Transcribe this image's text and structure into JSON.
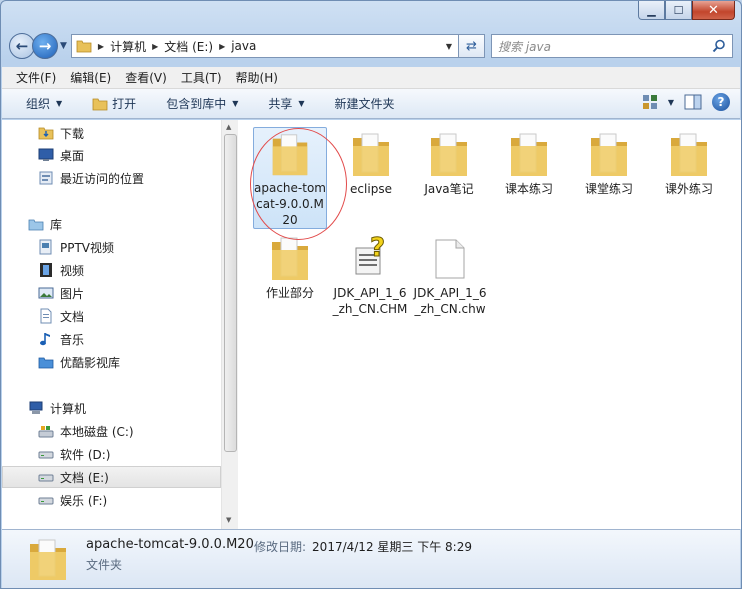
{
  "window": {
    "caption": {
      "minimize": "▁",
      "maximize": "☐",
      "close": "✕"
    }
  },
  "address": {
    "segments": [
      "计算机",
      "文档 (E:)",
      "java"
    ],
    "search_placeholder": "搜索 java"
  },
  "menubar": [
    "文件(F)",
    "编辑(E)",
    "查看(V)",
    "工具(T)",
    "帮助(H)"
  ],
  "commands": {
    "organize": "组织",
    "open": "打开",
    "include_library": "包含到库中",
    "share": "共享",
    "new_folder": "新建文件夹"
  },
  "navpane": {
    "favorites": [
      "下载",
      "桌面",
      "最近访问的位置"
    ],
    "library_title": "库",
    "libraries": [
      "PPTV视频",
      "视频",
      "图片",
      "文档",
      "音乐",
      "优酷影视库"
    ],
    "computer_title": "计算机",
    "drives": [
      "本地磁盘 (C:)",
      "软件 (D:)",
      "文档 (E:)",
      "娱乐 (F:)"
    ]
  },
  "content": {
    "items": [
      {
        "label": "apache-tomcat-9.0.0.M20",
        "type": "folder"
      },
      {
        "label": "eclipse",
        "type": "folder"
      },
      {
        "label": "Java笔记",
        "type": "folder"
      },
      {
        "label": "课本练习",
        "type": "folder"
      },
      {
        "label": "课堂练习",
        "type": "folder"
      },
      {
        "label": "课外练习",
        "type": "folder"
      },
      {
        "label": "作业部分",
        "type": "folder"
      },
      {
        "label": "JDK_API_1_6_zh_CN.CHM",
        "type": "chm"
      },
      {
        "label": "JDK_API_1_6_zh_CN.chw",
        "type": "file"
      }
    ]
  },
  "details": {
    "name": "apache-tomcat-9.0.0.M20",
    "modified_label": "修改日期:",
    "modified_value": "2017/4/12 星期三 下午 8:29",
    "type": "文件夹"
  },
  "colors": {
    "folder": "#e8c15a",
    "selection": "#cde3f8",
    "annotation": "#e24b4b"
  }
}
